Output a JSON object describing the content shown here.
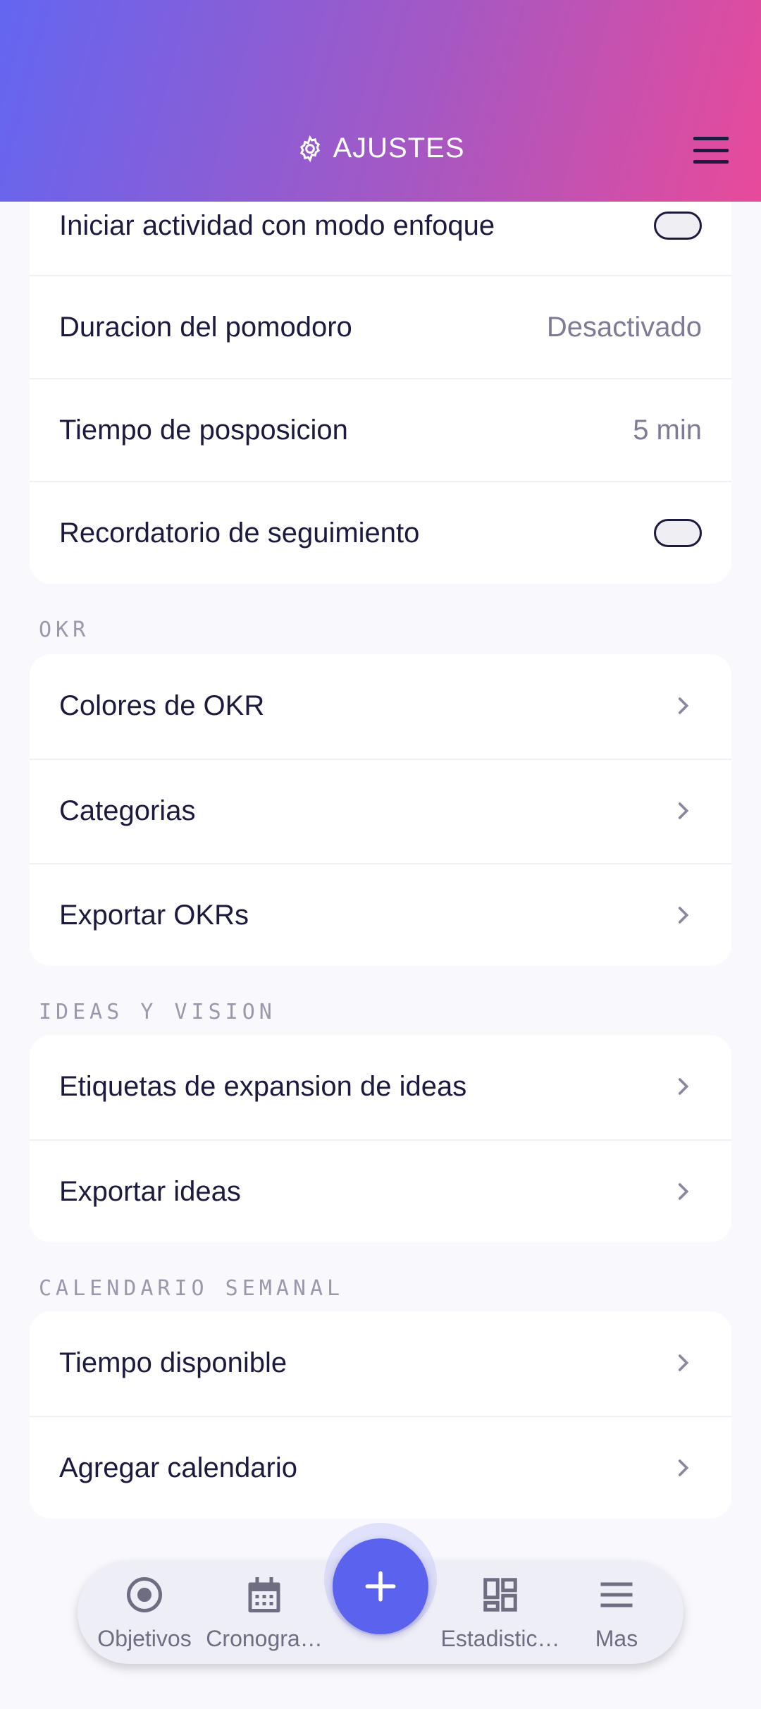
{
  "header": {
    "title": "AJUSTES",
    "icon": "gear-icon",
    "menu_icon": "hamburger-menu-icon"
  },
  "focus_section": {
    "items": [
      {
        "label": "Iniciar actividad con modo enfoque",
        "control": "toggle",
        "on": false
      },
      {
        "label": "Duracion del pomodoro",
        "value": "Desactivado"
      },
      {
        "label": "Tiempo de posposicion",
        "value": "5 min"
      },
      {
        "label": "Recordatorio de seguimiento",
        "control": "toggle",
        "on": false
      }
    ]
  },
  "okr_section": {
    "title": "OKR",
    "items": [
      {
        "label": "Colores de OKR"
      },
      {
        "label": "Categorias"
      },
      {
        "label": "Exportar OKRs"
      }
    ]
  },
  "ideas_section": {
    "title": "IDEAS Y VISION",
    "items": [
      {
        "label": "Etiquetas de expansion de ideas"
      },
      {
        "label": "Exportar ideas"
      }
    ]
  },
  "calendar_section": {
    "title": "CALENDARIO SEMANAL",
    "items": [
      {
        "label": "Tiempo disponible"
      },
      {
        "label": "Agregar calendario"
      }
    ]
  },
  "bottom_nav": {
    "items": [
      {
        "label": "Objetivos",
        "icon": "target-icon"
      },
      {
        "label": "Cronogra…",
        "icon": "calendar-icon"
      },
      {
        "label": "Estadistic…",
        "icon": "dashboard-icon"
      },
      {
        "label": "Mas",
        "icon": "menu-icon"
      }
    ],
    "fab_icon": "plus-icon"
  },
  "colors": {
    "header_gradient_start": "#6366f1",
    "header_gradient_end": "#e84a9a",
    "accent": "#5b63ee",
    "text": "#1c1a3e",
    "muted": "#7d7b96"
  }
}
